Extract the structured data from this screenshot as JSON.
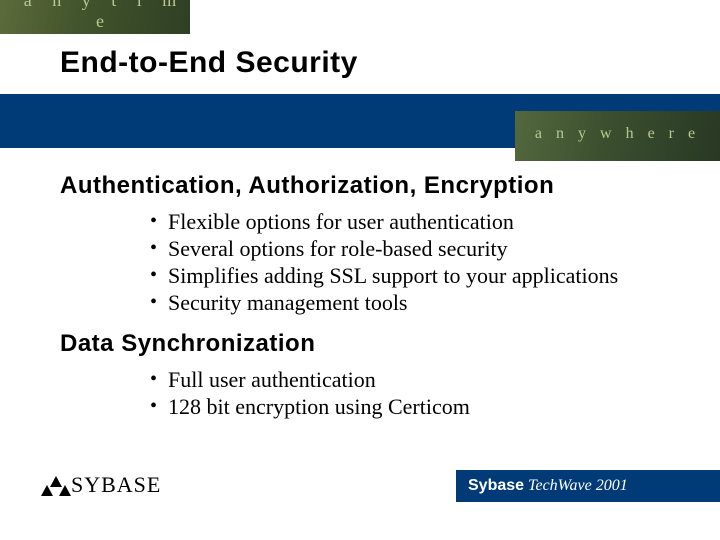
{
  "top_decor_text": "a n y t i m e",
  "right_decor_text": "a n y w h e r e",
  "title": "End-to-End Security",
  "sections": [
    {
      "heading": "Authentication, Authorization, Encryption",
      "bullets": [
        "Flexible options for user authentication",
        "Several options for role-based security",
        "Simplifies adding SSL support to your applications",
        "Security management tools"
      ]
    },
    {
      "heading": "Data Synchronization",
      "bullets": [
        "Full user authentication",
        "128 bit encryption using Certicom"
      ]
    }
  ],
  "footer": {
    "logo_text": "SYBASE",
    "bar_brand": "Sybase",
    "bar_event": "TechWave",
    "bar_year": "2001"
  }
}
